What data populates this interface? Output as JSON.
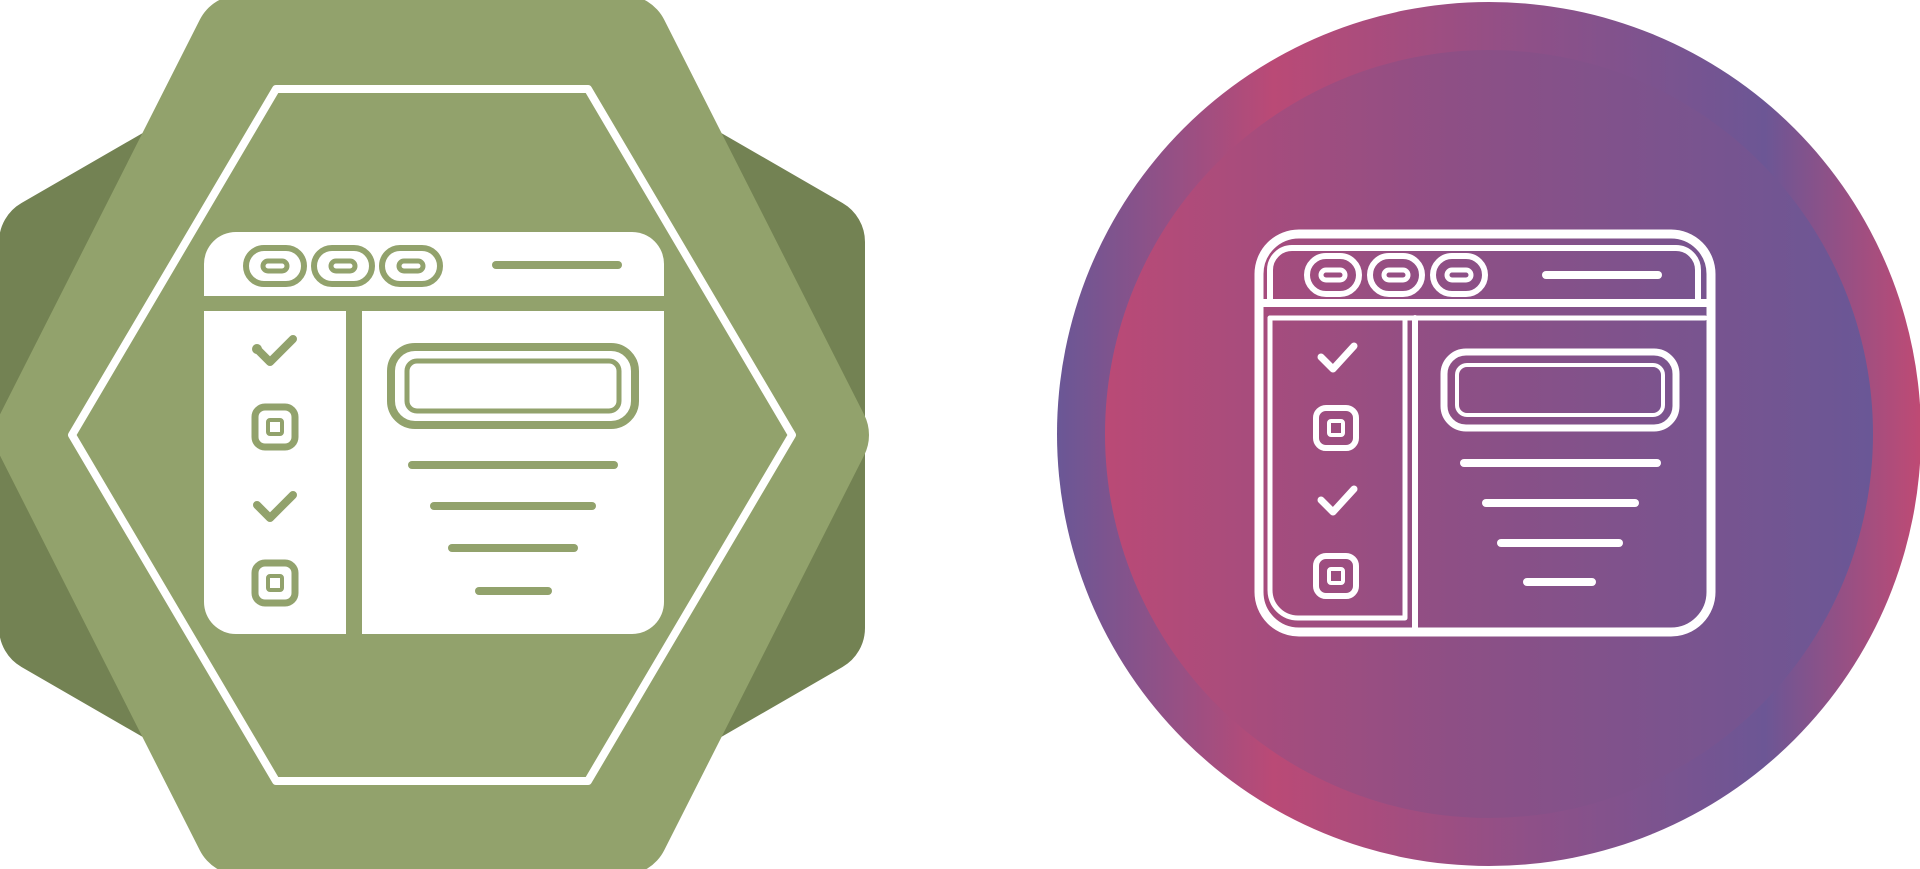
{
  "colors": {
    "background": "#ffffff",
    "green_dark": "#738253",
    "green_light": "#92A26C",
    "white": "#ffffff",
    "gradient_pink": "#BA4A76",
    "gradient_purple": "#6A5796",
    "gradient_mid": "#8E4F85"
  },
  "icons": [
    {
      "name": "browser-checklist-icon",
      "style": "glyph",
      "badge": "octagon-seal"
    },
    {
      "name": "browser-checklist-icon",
      "style": "outline",
      "badge": "gradient-circle"
    }
  ]
}
